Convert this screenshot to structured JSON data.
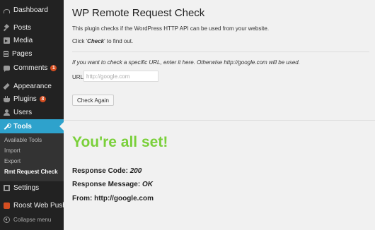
{
  "sidebar": {
    "dashboard": "Dashboard",
    "posts": "Posts",
    "media": "Media",
    "pages": "Pages",
    "comments": "Comments",
    "comments_count": "1",
    "appearance": "Appearance",
    "plugins": "Plugins",
    "plugins_count": "3",
    "users": "Users",
    "tools": "Tools",
    "submenu": [
      "Available Tools",
      "Import",
      "Export",
      "Rmt Request Check"
    ],
    "settings": "Settings",
    "roost": "Roost Web Push",
    "collapse": "Collapse menu"
  },
  "page": {
    "title": "WP Remote Request Check",
    "intro": "This plugin checks if the WordPress HTTP API can be used from your website.",
    "click_prefix": "Click '",
    "click_word": "Check",
    "click_suffix": "' to find out.",
    "url_hint": "If you want to check a specific URL, enter it here. Otherwise http://google.com will be used.",
    "url_label": "URL:",
    "url_placeholder": "http://google.com",
    "button": "Check Again",
    "success": "You're all set!",
    "response_code_label": "Response Code: ",
    "response_code": "200",
    "response_message_label": "Response Message: ",
    "response_message": "OK",
    "from_label": "From: ",
    "from": "http://google.com"
  },
  "colors": {
    "sidebar_bg": "#222222",
    "active": "#2ea2cc",
    "success": "#7ad03a",
    "badge": "#d54e21"
  }
}
